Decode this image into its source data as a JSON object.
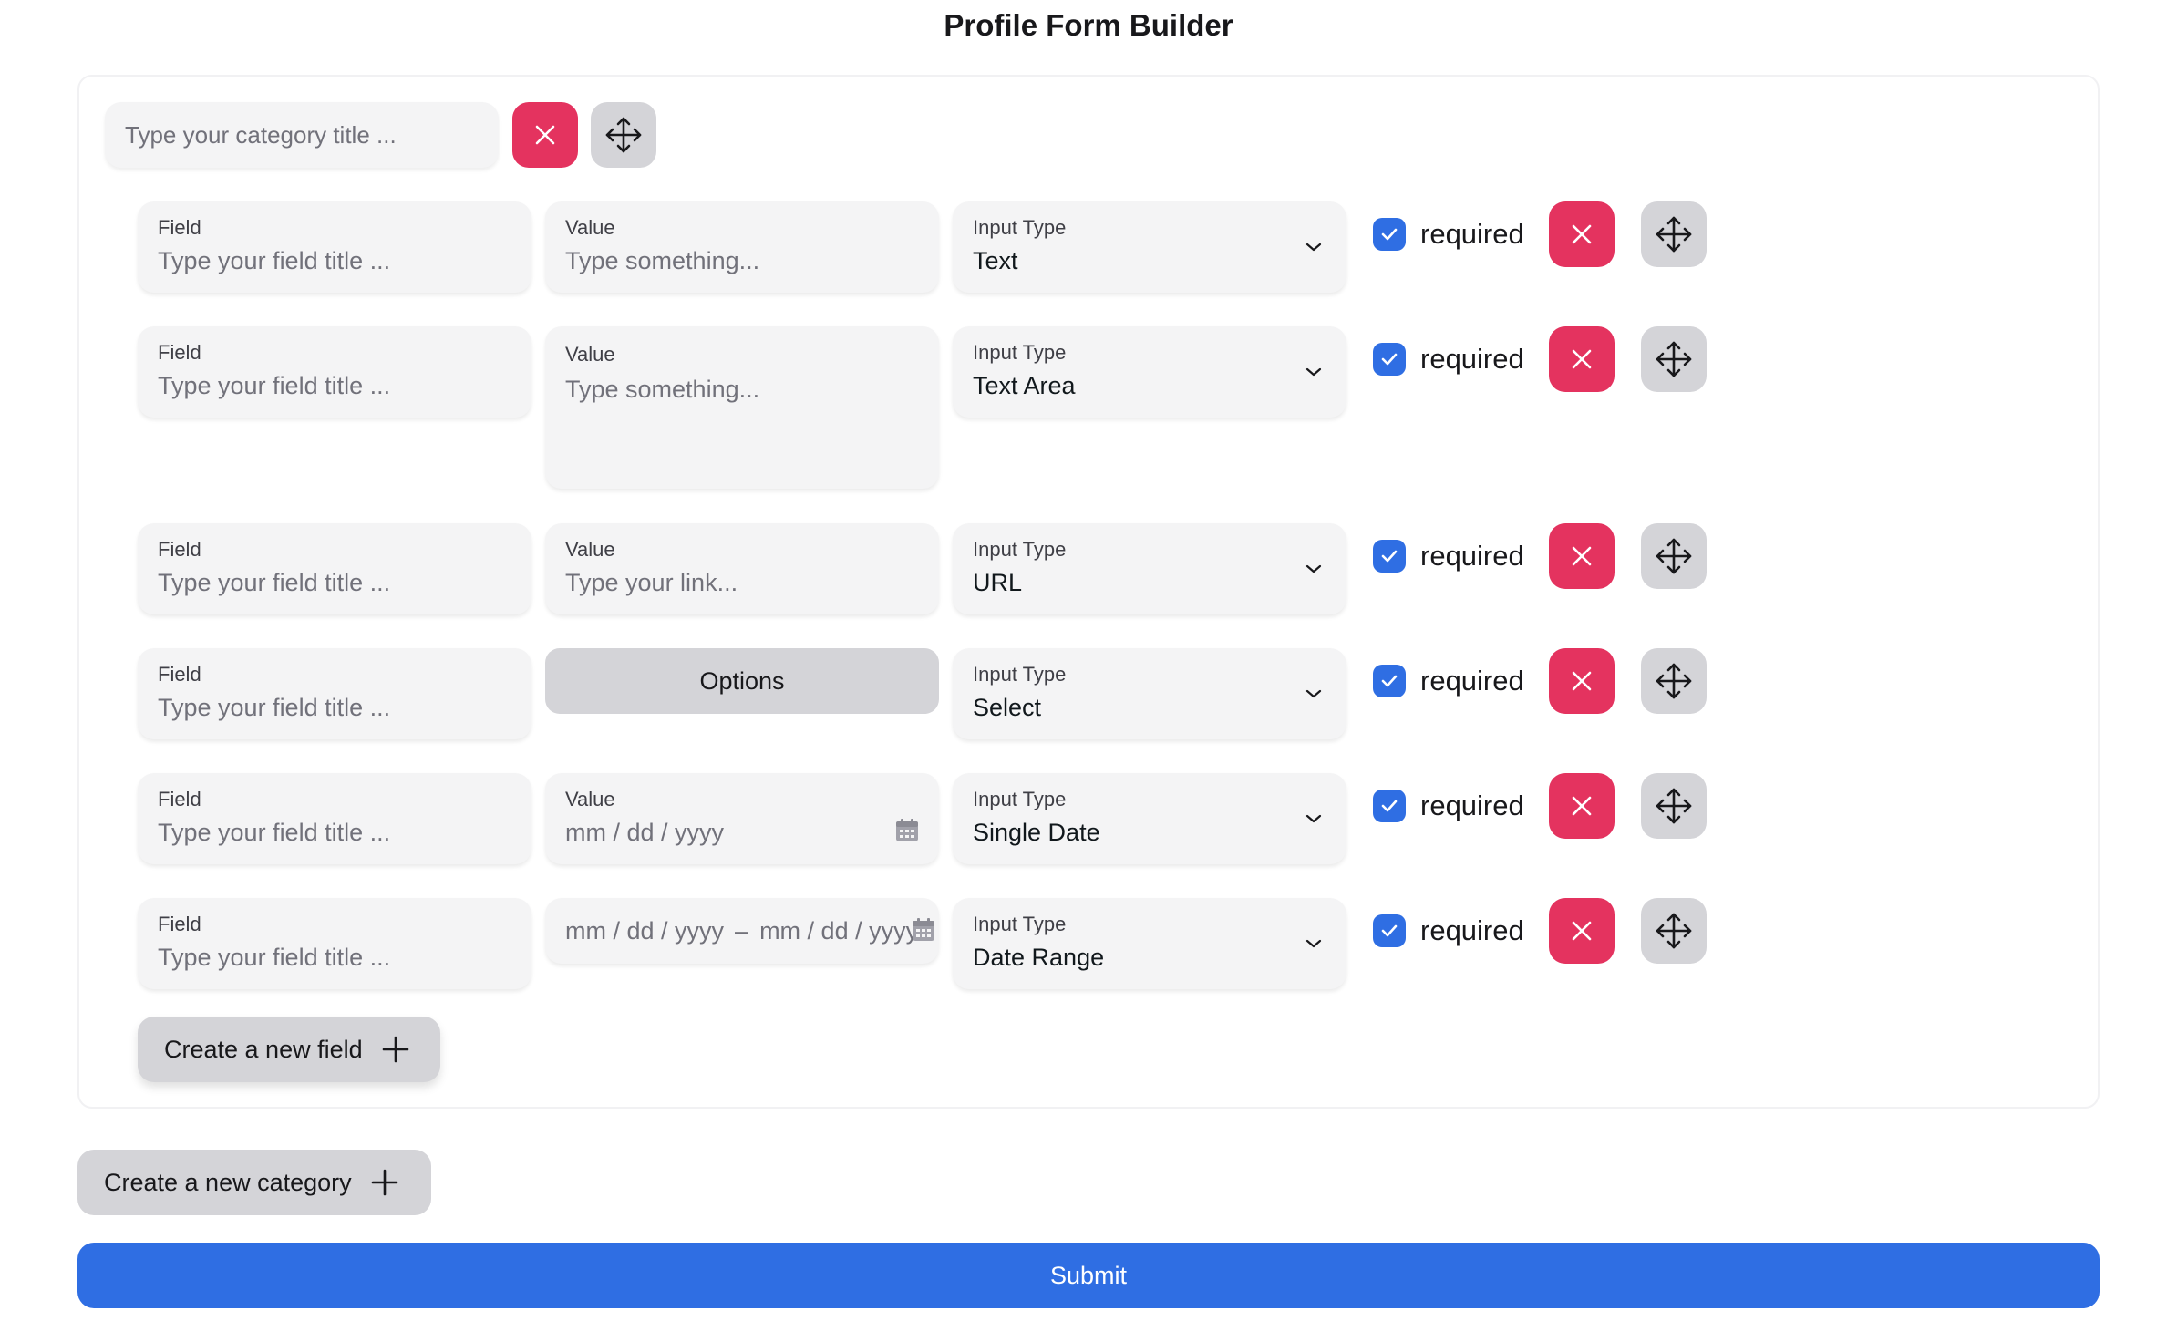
{
  "page": {
    "title": "Profile Form Builder"
  },
  "category": {
    "title_placeholder": "Type your category title ..."
  },
  "fields": [
    {
      "field_label": "Field",
      "field_placeholder": "Type your field title ...",
      "value_label": "Value",
      "value_placeholder": "Type something...",
      "input_type_label": "Input Type",
      "input_type": "Text",
      "required_label": "required",
      "required": true
    },
    {
      "field_label": "Field",
      "field_placeholder": "Type your field title ...",
      "value_label": "Value",
      "value_placeholder": "Type something...",
      "input_type_label": "Input Type",
      "input_type": "Text Area",
      "required_label": "required",
      "required": true
    },
    {
      "field_label": "Field",
      "field_placeholder": "Type your field title ...",
      "value_label": "Value",
      "value_placeholder": "Type your link...",
      "input_type_label": "Input Type",
      "input_type": "URL",
      "required_label": "required",
      "required": true
    },
    {
      "field_label": "Field",
      "field_placeholder": "Type your field title ...",
      "options_label": "Options",
      "input_type_label": "Input Type",
      "input_type": "Select",
      "required_label": "required",
      "required": true
    },
    {
      "field_label": "Field",
      "field_placeholder": "Type your field title ...",
      "value_label": "Value",
      "value_placeholder": "mm / dd / yyyy",
      "input_type_label": "Input Type",
      "input_type": "Single Date",
      "required_label": "required",
      "required": true
    },
    {
      "field_label": "Field",
      "field_placeholder": "Type your field title ...",
      "range_start": "mm / dd / yyyy",
      "range_sep": "–",
      "range_end": "mm / dd / yyyy",
      "input_type_label": "Input Type",
      "input_type": "Date Range",
      "required_label": "required",
      "required": true
    }
  ],
  "actions": {
    "create_field": "Create a new field",
    "create_category": "Create a new category",
    "submit": "Submit"
  },
  "colors": {
    "danger": "#e4335f",
    "primary": "#2f6ee3",
    "neutral": "#d4d4d8",
    "input_bg": "#f4f4f5"
  },
  "icons": {
    "delete": "close-icon",
    "drag": "move-icon",
    "dropdown": "chevron-down-icon",
    "add": "plus-icon",
    "calendar": "calendar-icon",
    "checkbox": "check-icon"
  }
}
